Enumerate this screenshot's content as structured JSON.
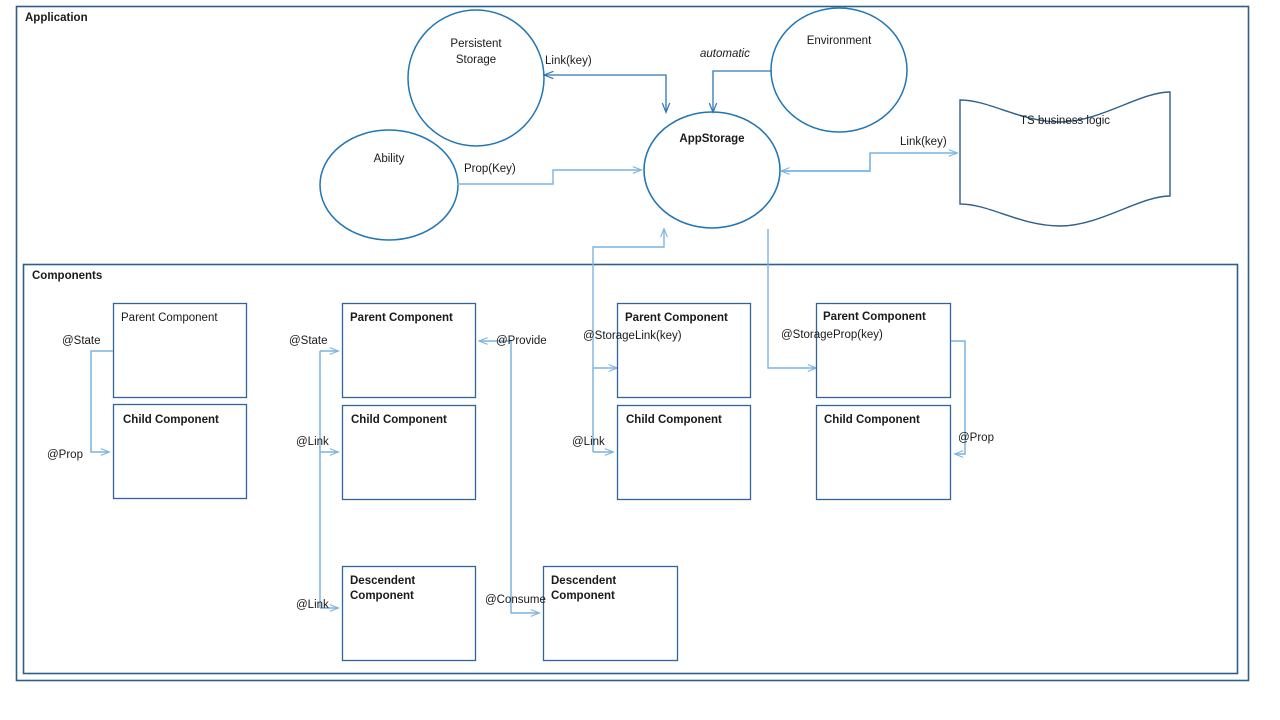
{
  "colors": {
    "frame_border": "#2e5f8a",
    "node_stroke": "#1f77b4",
    "box_stroke": "#31639c",
    "connector": "#7cb4e0",
    "connector_dark": "#2e75b6",
    "text": "#1a1a1a",
    "background": "#ffffff"
  },
  "frames": [
    {
      "title": "Application"
    },
    {
      "title": "Components"
    }
  ],
  "nodes": [
    {
      "id": "persistent-storage",
      "label": "Persistent\nStorage",
      "bold": false
    },
    {
      "id": "ability",
      "label": "Ability",
      "bold": false
    },
    {
      "id": "appstorage",
      "label": "AppStorage",
      "bold": true
    },
    {
      "id": "environment",
      "label": "Environment",
      "bold": false
    },
    {
      "id": "ts-business-logic",
      "label": "TS business logic",
      "bold": false
    }
  ],
  "component_groups": [
    {
      "id": "group-1",
      "boxes": [
        {
          "id": "parent-1",
          "label": "Parent Component",
          "bold": false
        },
        {
          "id": "child-1",
          "label": "Child Component",
          "bold": true
        }
      ],
      "edges": [
        {
          "id": "state-1",
          "label": "@State"
        },
        {
          "id": "prop-1",
          "label": "@Prop"
        }
      ]
    },
    {
      "id": "group-2",
      "boxes": [
        {
          "id": "parent-2",
          "label": "Parent Component",
          "bold": true
        },
        {
          "id": "child-2",
          "label": "Child Component",
          "bold": true
        },
        {
          "id": "descendent-2",
          "label": "Descendent\nComponent",
          "bold": true
        }
      ],
      "edges": [
        {
          "id": "state-2",
          "label": "@State"
        },
        {
          "id": "link-2a",
          "label": "@Link"
        },
        {
          "id": "link-2b",
          "label": "@Link"
        },
        {
          "id": "provide-2",
          "label": "@Provide"
        }
      ]
    },
    {
      "id": "group-3",
      "boxes": [
        {
          "id": "descendent-3",
          "label": "Descendent\nComponent",
          "bold": true
        }
      ],
      "edges": [
        {
          "id": "consume-3",
          "label": "@Consume"
        }
      ]
    },
    {
      "id": "group-4",
      "boxes": [
        {
          "id": "parent-4",
          "label": "Parent Component",
          "bold": true
        },
        {
          "id": "child-4",
          "label": "Child Component",
          "bold": true
        }
      ],
      "edges": [
        {
          "id": "storagelink-4",
          "label": "@StorageLink(key)"
        },
        {
          "id": "link-4",
          "label": "@Link"
        }
      ]
    },
    {
      "id": "group-5",
      "boxes": [
        {
          "id": "parent-5",
          "label": "Parent Component",
          "bold": true
        },
        {
          "id": "child-5",
          "label": "Child Component",
          "bold": true
        }
      ],
      "edges": [
        {
          "id": "storageprop-5",
          "label": "@StorageProp(key)"
        },
        {
          "id": "prop-5",
          "label": "@Prop"
        }
      ]
    }
  ],
  "application_edges": [
    {
      "id": "link-key-storage",
      "label": "Link(key)",
      "italic": false
    },
    {
      "id": "prop-key-ability",
      "label": "Prop(Key)",
      "italic": false
    },
    {
      "id": "automatic-environment",
      "label": "automatic",
      "italic": true
    },
    {
      "id": "link-key-ts",
      "label": "Link(key)",
      "italic": false
    }
  ]
}
